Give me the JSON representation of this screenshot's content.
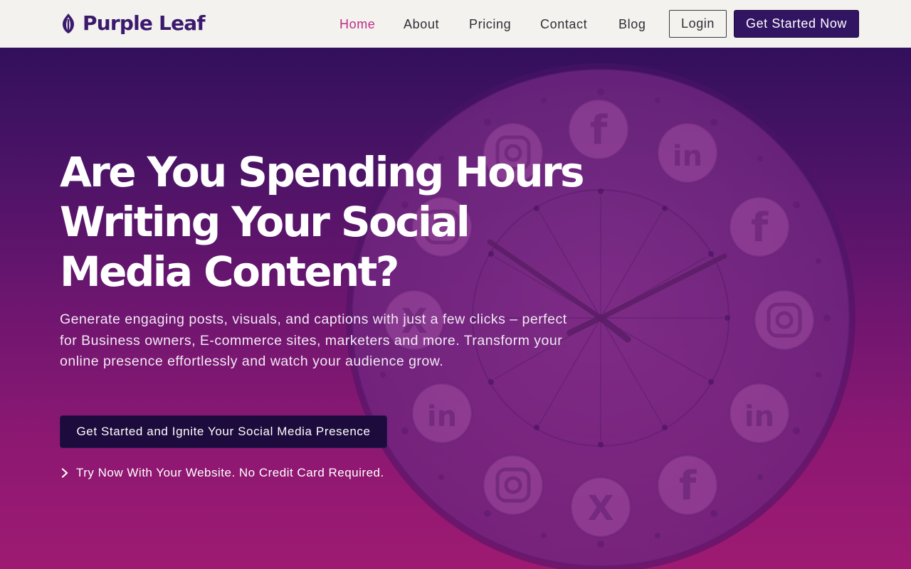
{
  "brand": {
    "name": "Purple Leaf",
    "logo_icon": "leaf-icon",
    "color": "#3b1a6e"
  },
  "nav": {
    "items": [
      {
        "label": "Home",
        "active": true
      },
      {
        "label": "About",
        "active": false
      },
      {
        "label": "Pricing",
        "active": false
      },
      {
        "label": "Contact",
        "active": false
      },
      {
        "label": "Blog",
        "active": false
      }
    ],
    "login_label": "Login",
    "get_started_label": "Get Started Now"
  },
  "hero": {
    "title": "Are You Spending Hours Writing Your Social Media Content?",
    "subtitle": "Generate engaging posts, visuals, and captions with just a few clicks – perfect for Business owners, E-commerce sites, marketers and more. Transform your online presence effortlessly and watch your audience grow.",
    "cta_label": "Get Started and Ignite Your Social Media Presence",
    "note": "Try Now With Your Website. No Credit Card Required.",
    "note_icon": "chevron-right-icon",
    "background_image": "clock with social media icons (facebook, linkedin, instagram, x)"
  },
  "colors": {
    "accent_active": "#c02c82",
    "primary_button": "#311462",
    "cta_button": "#1c0b3c",
    "header_bg": "#f3f2ef"
  }
}
